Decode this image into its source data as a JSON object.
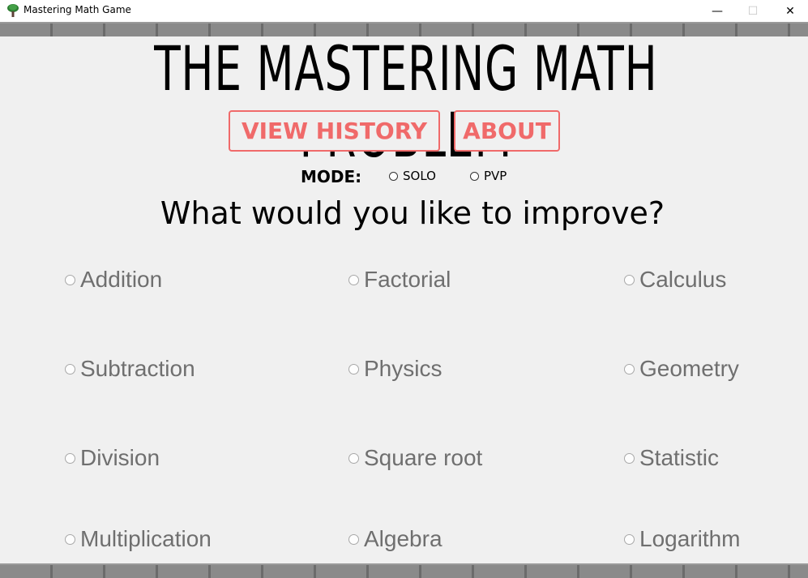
{
  "window": {
    "title": "Mastering Math Game",
    "controls": {
      "minimize": "—",
      "maximize": "☐",
      "close": "✕"
    }
  },
  "header": {
    "title": "THE MASTERING MATH PROBLEM",
    "buttons": {
      "view_history": "VIEW HISTORY",
      "about": "ABOUT"
    }
  },
  "mode": {
    "label": "MODE:",
    "options": [
      "SOLO",
      "PVP"
    ]
  },
  "question": "What would you like to improve?",
  "topics": [
    "Addition",
    "Factorial",
    "Calculus",
    "Subtraction",
    "Physics",
    "Geometry",
    "Division",
    "Square root",
    "Statistic",
    "Multiplication",
    "Algebra",
    "Logarithm"
  ],
  "colors": {
    "accent": "#f06a6a",
    "background": "#f0f0f0",
    "topic_text": "#6f6f6f"
  }
}
